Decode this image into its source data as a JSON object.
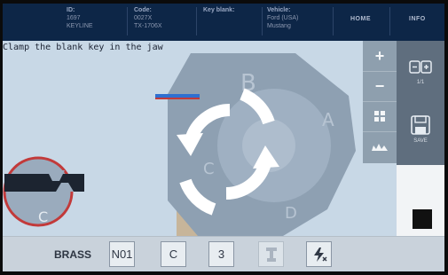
{
  "header": {
    "id_label": "ID:",
    "id_value": "1697",
    "id_brand": "KEYLINE",
    "code_label": "Code:",
    "code_value": "0027X",
    "code_value2": "TX-1706X",
    "keyblank_label": "Key blank:",
    "vehicle_label": "Vehicle:",
    "vehicle_make": "Ford (USA)",
    "vehicle_model": "Mustang",
    "home_label": "HOME",
    "info_label": "INFO"
  },
  "message": "Clamp the blank key in the jaw",
  "diagram": {
    "sides": [
      "A",
      "B",
      "C",
      "D"
    ],
    "inset_label": "C"
  },
  "zoom": {
    "plus": "+",
    "minus": "−"
  },
  "side": {
    "page_label": "1/1",
    "save_label": "SAVE"
  },
  "toolbar": {
    "material": "BRASS",
    "b1": "N01",
    "b2": "C",
    "b3": "3"
  },
  "colors": {
    "header_bg": "#0d2647",
    "screen_bg": "#c8d8e6",
    "cylinder": "#8ea0b2",
    "inset_ring": "#c23a3a",
    "blue_marker": "#2f6fd0"
  }
}
